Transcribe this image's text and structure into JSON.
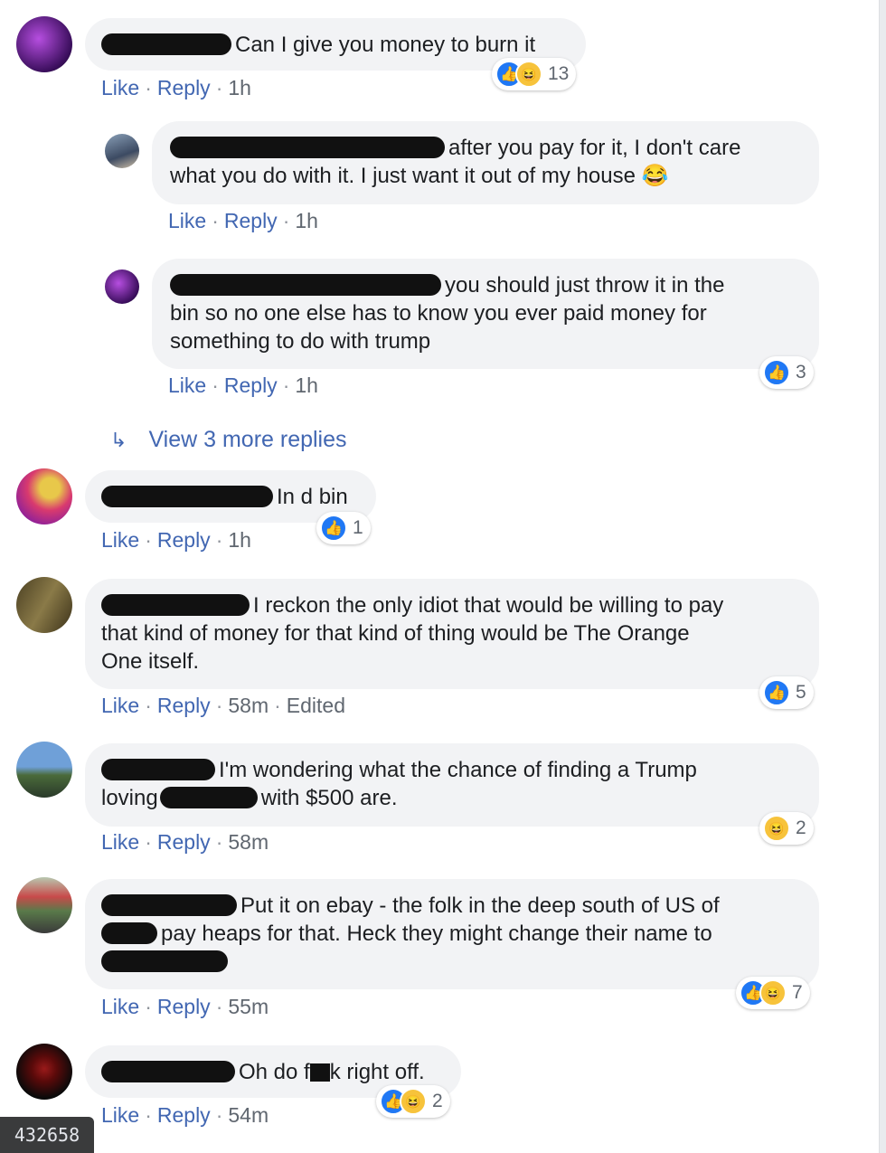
{
  "actions": {
    "like": "Like",
    "reply": "Reply",
    "sep": "·"
  },
  "view_more": "View 3 more replies",
  "id_tag": "432658",
  "comments": [
    {
      "text": "Can I give you money to burn it",
      "time": "1h",
      "reactions": [
        "like",
        "haha"
      ],
      "count": "13"
    },
    {
      "text_1": "after you pay for it, I don't care",
      "text_2": "what you do with it. I just want it out of my house",
      "emoji": "😂",
      "time": "1h"
    },
    {
      "text_1": "you should just throw it in the",
      "text_2": "bin so no one else has to know you ever paid money for",
      "text_3": "something to do with trump",
      "time": "1h",
      "reactions": [
        "like"
      ],
      "count": "3"
    },
    {
      "text": "In d bin",
      "time": "1h",
      "reactions": [
        "like"
      ],
      "count": "1"
    },
    {
      "text_1": "I reckon the only idiot that would be willing to pay",
      "text_2": "that kind of money for that kind of thing would be The Orange",
      "text_3": "One itself.",
      "time": "58m",
      "edited": "Edited",
      "reactions": [
        "like"
      ],
      "count": "5"
    },
    {
      "text_1": "I'm wondering what the chance of finding a Trump",
      "text_2a": "loving",
      "text_2b": "with $500 are.",
      "time": "58m",
      "reactions": [
        "haha"
      ],
      "count": "2"
    },
    {
      "text_1": "Put it on ebay - the folk in the deep south of US of",
      "text_2": "pay heaps for that. Heck they might change their name to",
      "time": "55m",
      "reactions": [
        "like",
        "haha"
      ],
      "count": "7"
    },
    {
      "text_a": "Oh do f",
      "text_b": "k right off.",
      "time": "54m",
      "reactions": [
        "like",
        "haha"
      ],
      "count": "2"
    }
  ],
  "colors": {
    "bubble": "#f2f3f5",
    "link": "#4267b2",
    "like": "#2078f4",
    "haha": "#f7c33b"
  }
}
